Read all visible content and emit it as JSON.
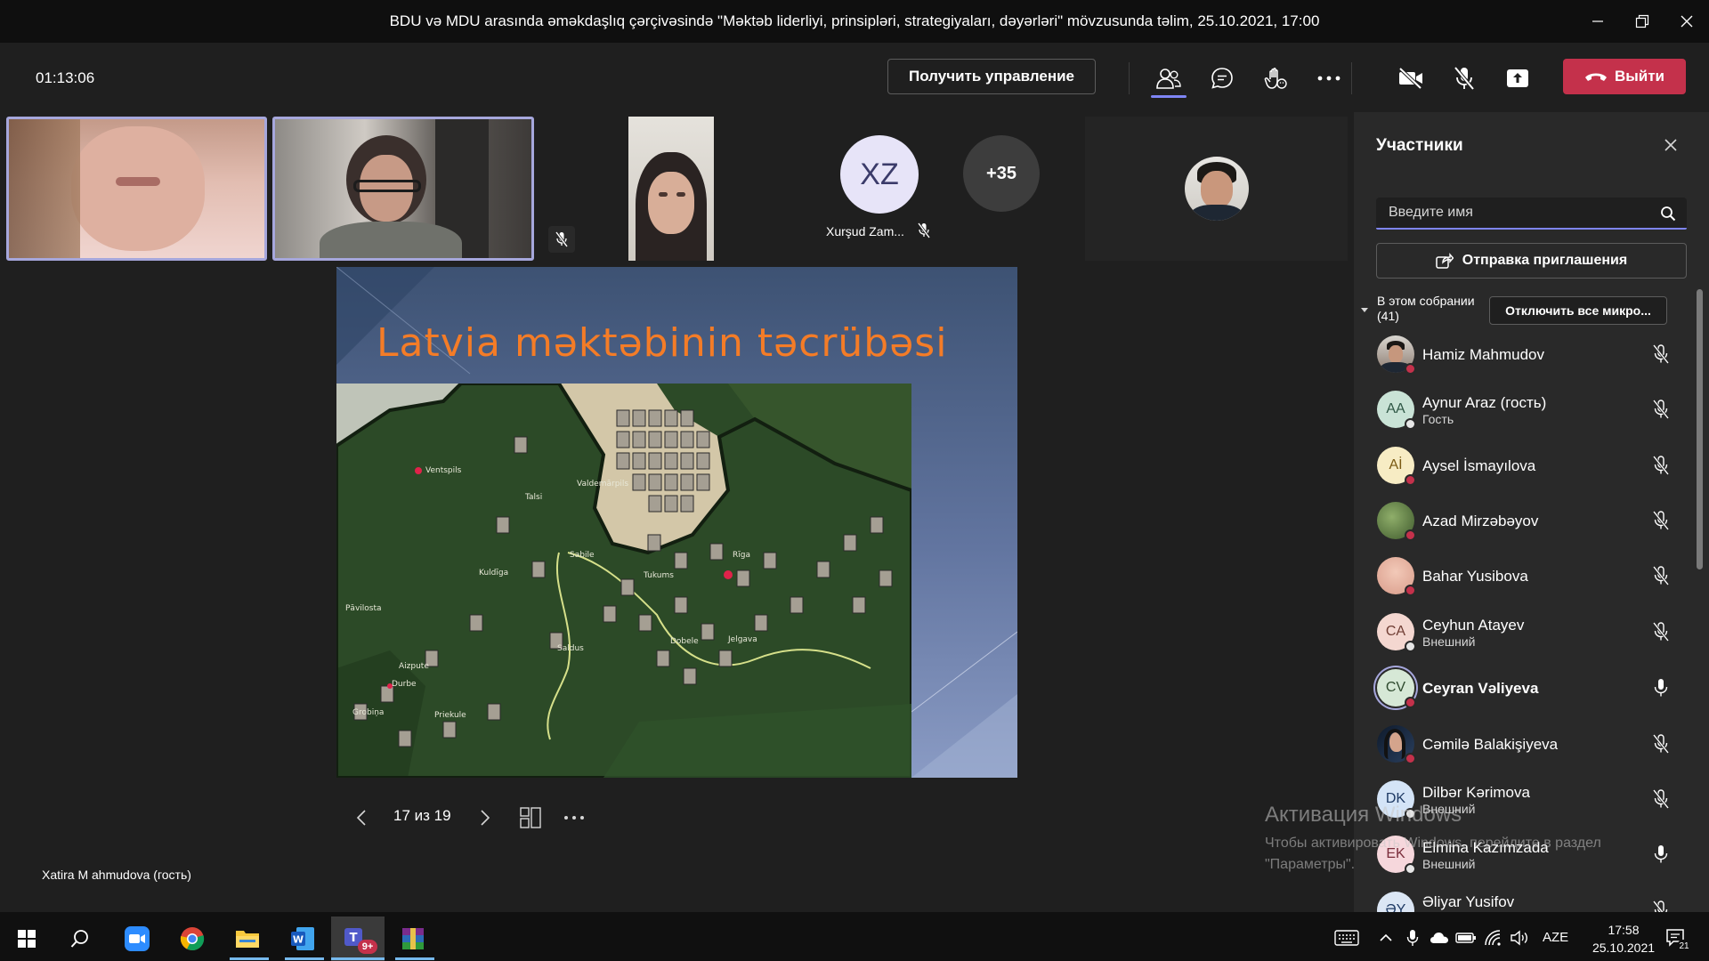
{
  "window": {
    "title": "BDU və MDU arasında əməkdaşlıq çərçivəsində \"Məktəb liderliyi, prinsipləri, strategiyaları, dəyərləri\" mövzusunda təlim, 25.10.2021, 17:00"
  },
  "toolbar": {
    "timer": "01:13:06",
    "control_label": "Получить управление",
    "leave_label": "Выйти",
    "accent": "#7f85f5",
    "leave_color": "#c4314b"
  },
  "stage": {
    "xz_initials": "XZ",
    "xz_name": "Xurşud Zam...",
    "overflow_count": "+35",
    "presenter": "Xatira M ahmudova (гость)"
  },
  "slide": {
    "title": "Latvia məktəbinin təcrübəsi",
    "counter": "17 из 19",
    "map_labels": [
      "Ventspils",
      "Pāvilosta",
      "Aizpute",
      "Grobiņa",
      "Priekule",
      "Durbe",
      "Kuldīga",
      "Talsi",
      "Tukums",
      "Dobele",
      "Jelgava",
      "Rīga",
      "Sabile",
      "Valdemārpils",
      "Saldus"
    ]
  },
  "panel": {
    "title": "Участники",
    "search_placeholder": "Введите имя",
    "invite_label": "Отправка приглашения",
    "section_label": "В этом собрании (41)",
    "mute_all_label": "Отключить все микро...",
    "participants": [
      {
        "name": "Hamiz Mahmudov",
        "sub": "",
        "initials": "",
        "mic": "off"
      },
      {
        "name": "Aynur Araz (гость)",
        "sub": "Гость",
        "initials": "AA",
        "mic": "off"
      },
      {
        "name": "Aysel İsmayılova",
        "sub": "",
        "initials": "Aİ",
        "mic": "off"
      },
      {
        "name": "Azad Mirzəbəyov",
        "sub": "",
        "initials": "",
        "mic": "off"
      },
      {
        "name": "Bahar Yusibova",
        "sub": "",
        "initials": "",
        "mic": "off"
      },
      {
        "name": "Ceyhun Atayev",
        "sub": "Внешний",
        "initials": "CA",
        "mic": "off"
      },
      {
        "name": "Ceyran Vəliyeva",
        "sub": "",
        "initials": "CV",
        "mic": "on"
      },
      {
        "name": "Cəmilə Balakişiyeva",
        "sub": "",
        "initials": "",
        "mic": "off"
      },
      {
        "name": "Dilbər Kərimova",
        "sub": "Внешний",
        "initials": "DK",
        "mic": "off"
      },
      {
        "name": "Elmina Kazımzada",
        "sub": "Внешний",
        "initials": "EK",
        "mic": "on"
      },
      {
        "name": "Əliyar Yusifov",
        "sub": "",
        "initials": "ƏY",
        "mic": "off"
      }
    ]
  },
  "watermark": {
    "title": "Активация Windows",
    "text": "Чтобы активировать Windows, перейдите в раздел \"Параметры\"."
  },
  "taskbar": {
    "teams_badge": "9+",
    "lang": "AZE",
    "time": "17:58",
    "date": "25.10.2021",
    "notif_count": "21"
  }
}
